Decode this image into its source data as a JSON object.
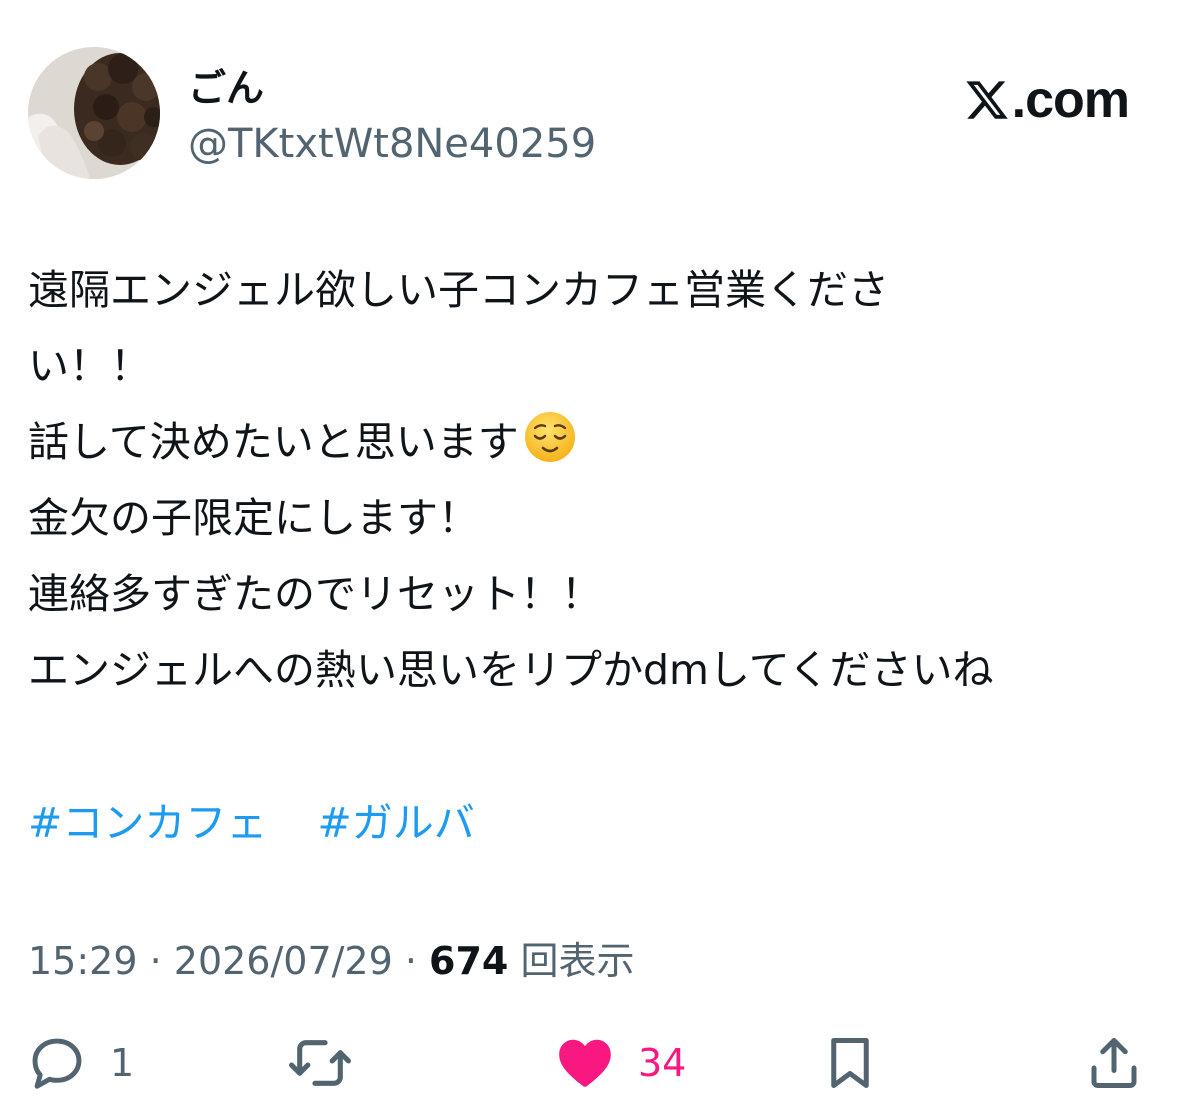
{
  "user": {
    "display_name": "ごん",
    "handle": "@TKtxtWt8Ne40259",
    "avatar_icon": "avatar-photo"
  },
  "brand": {
    "logo_icon": "x-logo-icon",
    "text": ".com"
  },
  "tweet": {
    "lines": [
      "遠隔エンジェル欲しい子コンカフェ営業くださ",
      "い！！",
      "話して決めたいと思います",
      "金欠の子限定にします！",
      "連絡多すぎたのでリセット！！",
      "エンジェルへの熱い思いをリプかdmしてくださいね"
    ],
    "emoji": "relieved-face",
    "hashtags": [
      "#コンカフェ",
      "#ガルバ"
    ]
  },
  "meta": {
    "time": "15:29",
    "separator": " · ",
    "date": "2026/07/29",
    "views": "674",
    "views_label": "回表示"
  },
  "actions": {
    "reply": {
      "icon": "reply-icon",
      "count": "1"
    },
    "retweet": {
      "icon": "retweet-icon",
      "count": ""
    },
    "like": {
      "icon": "heart-icon",
      "count": "34",
      "active": true
    },
    "bookmark": {
      "icon": "bookmark-icon"
    },
    "share": {
      "icon": "share-icon"
    }
  },
  "colors": {
    "text": "#0f1419",
    "secondary": "#536471",
    "link": "#1d9bf0",
    "like": "#f91880"
  }
}
